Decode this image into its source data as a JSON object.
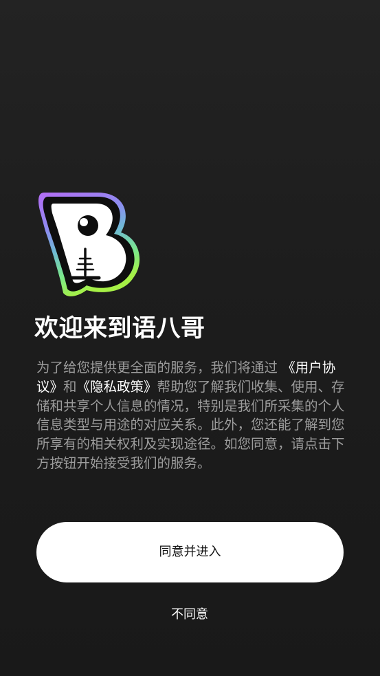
{
  "welcome": {
    "title": "欢迎来到语八哥"
  },
  "privacy_notice": {
    "text_before": "为了给您提供更全面的服务，我们将通过",
    "user_agreement_link": "《用户协议》",
    "connector": "和",
    "privacy_policy_link": "《隐私政策》",
    "text_after": "帮助您了解我们收集、使用、存储和共享个人信息的情况，特别是我们所采集的个人信息类型与用途的对应关系。此外，您还能了解到您所享有的相关权利及实现途径。如您同意，请点击下方按钮开始接受我们的服务。"
  },
  "actions": {
    "agree_label": "同意并进入",
    "disagree_label": "不同意"
  },
  "colors": {
    "background": "#1e1e1e",
    "body_text": "#9c9c9c",
    "link_text": "#ffffff",
    "primary_button_bg": "#ffffff",
    "logo_gradient": [
      "#b56cf5",
      "#6fa8e8",
      "#7be889",
      "#9ef04a"
    ]
  },
  "icons": {
    "logo": "app-logo-b-microphone-icon"
  }
}
